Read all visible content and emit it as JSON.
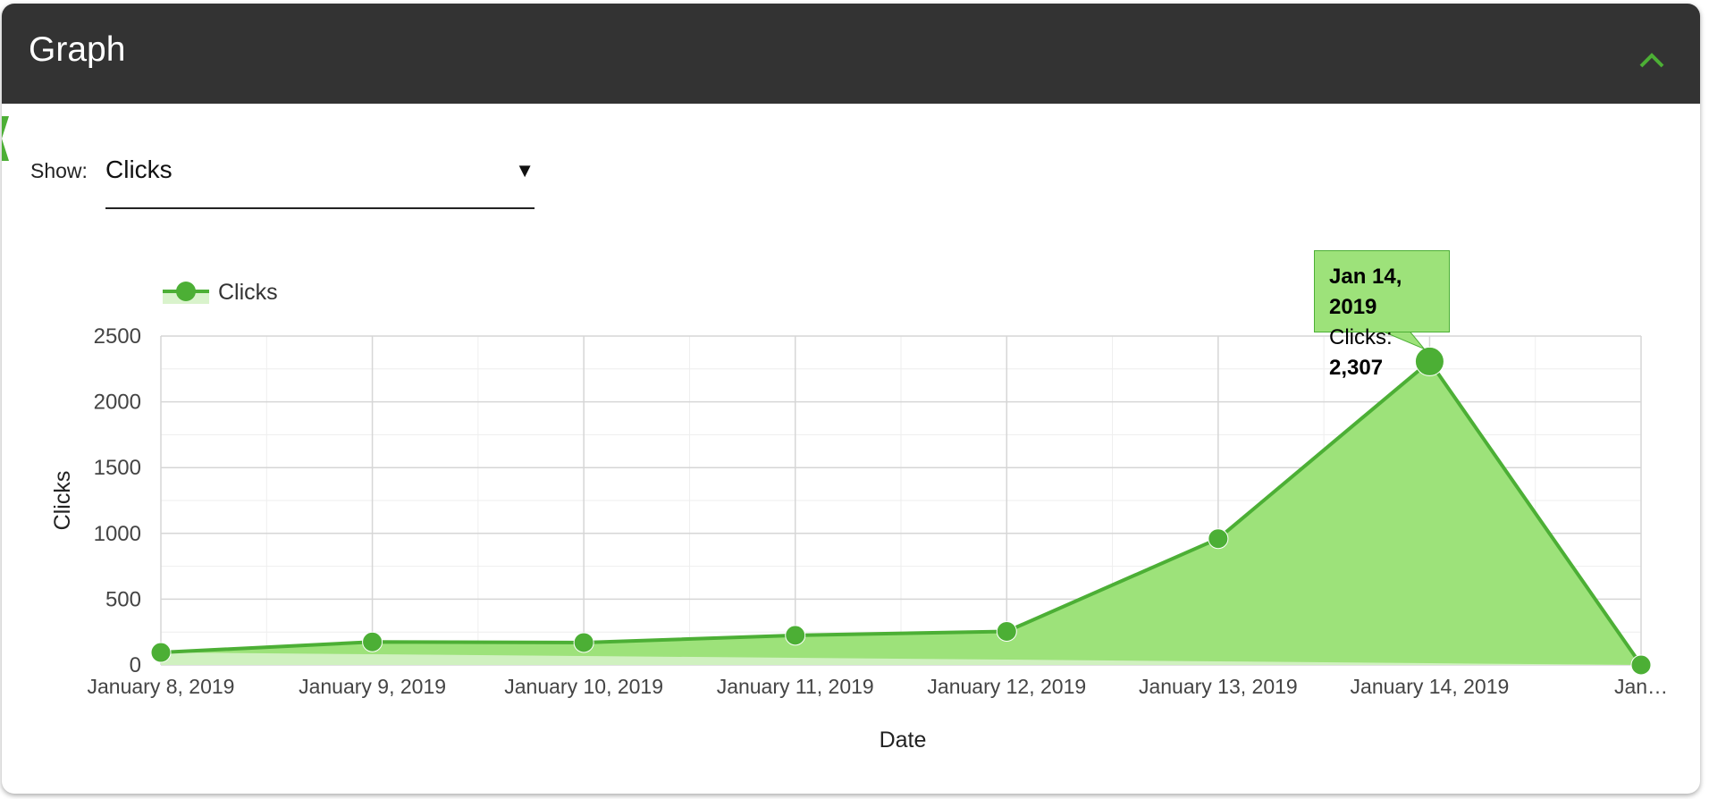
{
  "header": {
    "title": "Graph"
  },
  "filter": {
    "label": "Show:",
    "selected": "Clicks"
  },
  "tooltip": {
    "date": "Jan 14, 2019",
    "series_label": "Clicks:",
    "value": "2,307"
  },
  "colors": {
    "header_bg": "#333333",
    "accent": "#4caf35",
    "fill": "#9de27a",
    "fill_light": "#d9f3cc"
  },
  "chart_data": {
    "type": "area",
    "xlabel": "Date",
    "ylabel": "Clicks",
    "x": [
      "January 8, 2019",
      "January 9, 2019",
      "January 10, 2019",
      "January 11, 2019",
      "January 12, 2019",
      "January 13, 2019",
      "January 14, 2019",
      "Jan…"
    ],
    "series": [
      {
        "name": "Clicks",
        "values": [
          95,
          175,
          170,
          225,
          255,
          960,
          2307,
          0
        ]
      }
    ],
    "ylim": [
      0,
      2500
    ],
    "yticks": [
      0,
      500,
      1000,
      1500,
      2000,
      2500
    ],
    "grid": true,
    "legend": "top-left",
    "highlighted_index": 6
  }
}
